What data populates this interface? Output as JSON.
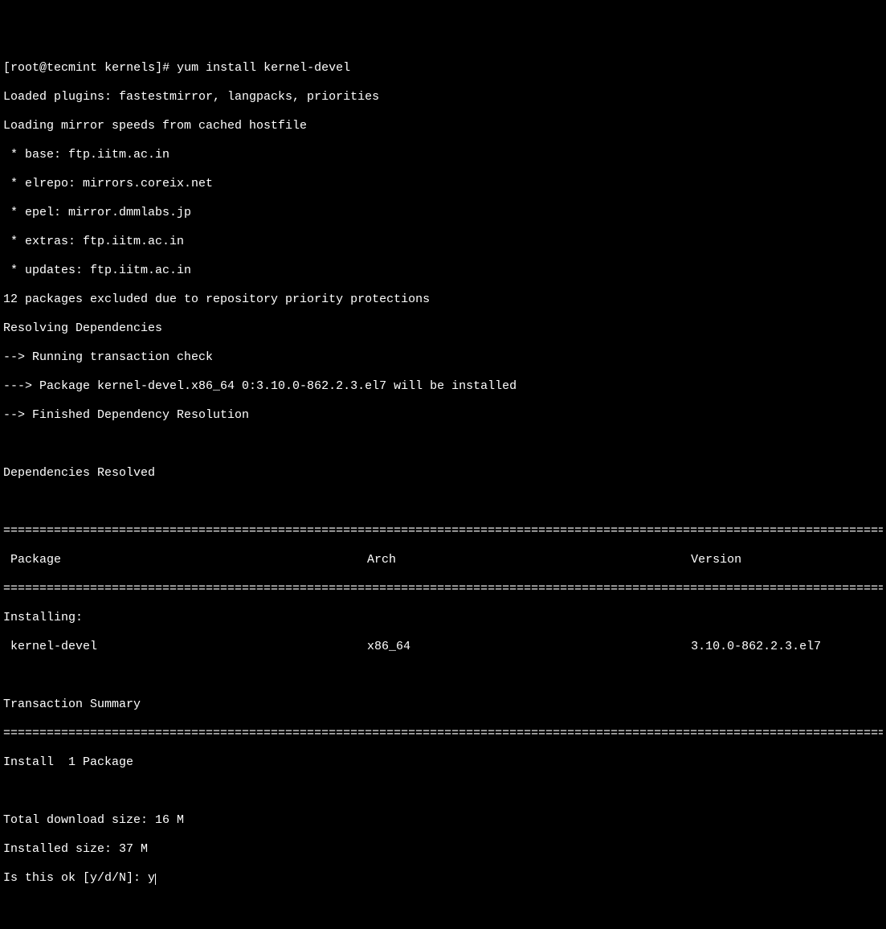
{
  "prompt": {
    "user": "root",
    "host": "tecmint",
    "dir": "kernels",
    "symbol": "#",
    "command": "yum install kernel-devel"
  },
  "output": {
    "line1": "Loaded plugins: fastestmirror, langpacks, priorities",
    "line2": "Loading mirror speeds from cached hostfile",
    "mirror1": " * base: ftp.iitm.ac.in",
    "mirror2": " * elrepo: mirrors.coreix.net",
    "mirror3": " * epel: mirror.dmmlabs.jp",
    "mirror4": " * extras: ftp.iitm.ac.in",
    "mirror5": " * updates: ftp.iitm.ac.in",
    "excluded": "12 packages excluded due to repository priority protections",
    "resolving": "Resolving Dependencies",
    "check": "--> Running transaction check",
    "package_install": "---> Package kernel-devel.x86_64 0:3.10.0-862.2.3.el7 will be installed",
    "finished": "--> Finished Dependency Resolution",
    "deps_resolved": "Dependencies Resolved"
  },
  "table": {
    "header": {
      "package": " Package",
      "arch": "Arch",
      "version": "Version"
    },
    "installing_label": "Installing:",
    "row": {
      "package": " kernel-devel",
      "arch": "x86_64",
      "version": "3.10.0-862.2.3.el7"
    }
  },
  "summary": {
    "title": "Transaction Summary",
    "install": "Install  1 Package",
    "download_size": "Total download size: 16 M",
    "installed_size": "Installed size: 37 M",
    "confirm_prompt": "Is this ok [y/d/N]: ",
    "confirm_input": "y"
  },
  "separator": "==========================================================================================================================="
}
